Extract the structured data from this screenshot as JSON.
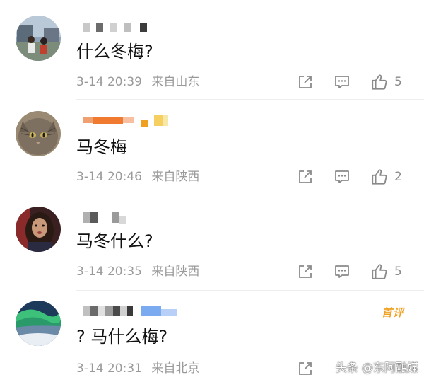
{
  "comments": [
    {
      "text": "什么冬梅?",
      "date": "3-14 20:39",
      "location": "来自山东",
      "likes": "5",
      "badge": ""
    },
    {
      "text": "马冬梅",
      "date": "3-14 20:46",
      "location": "来自陕西",
      "likes": "2",
      "badge": ""
    },
    {
      "text": "马冬什么?",
      "date": "3-14 20:35",
      "location": "来自陕西",
      "likes": "5",
      "badge": ""
    },
    {
      "text": "? 马什么梅?",
      "date": "3-14 20:31",
      "location": "来自北京",
      "likes": "",
      "badge": "首评"
    }
  ],
  "icons": {
    "share": "share-icon",
    "comment": "comment-icon",
    "like": "thumbs-up-icon"
  },
  "watermark": "头条 @东阿融媒",
  "colors": {
    "meta_text": "#9a9a9a",
    "icon": "#8a8a8a",
    "badge": "#f0a020"
  }
}
